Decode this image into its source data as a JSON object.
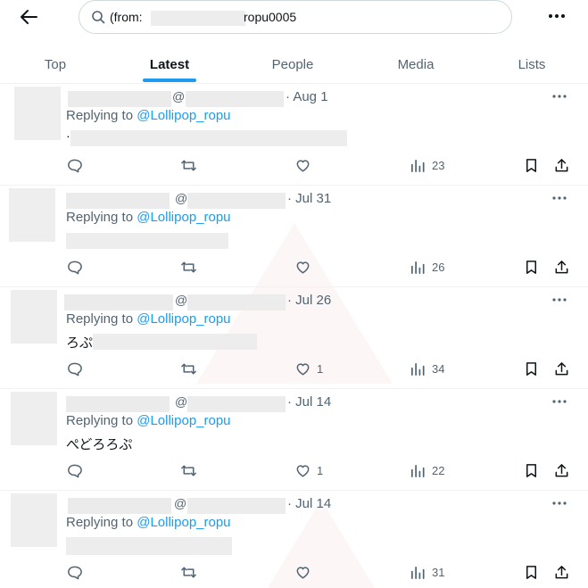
{
  "header": {
    "search_prefix": "(from:",
    "search_suffix": "ropu0005"
  },
  "tabs": [
    {
      "label": "Top"
    },
    {
      "label": "Latest"
    },
    {
      "label": "People"
    },
    {
      "label": "Media"
    },
    {
      "label": "Lists"
    }
  ],
  "active_tab": "Latest",
  "accent_color": "#1d9bf0",
  "tweets": [
    {
      "at": "@",
      "date": "· Aug 1",
      "replying_prefix": "Replying to ",
      "replying_handle": "@Lollipop_ropu",
      "body_text": "·",
      "likes": "",
      "views": "23"
    },
    {
      "at": "@",
      "date": "· Jul 31",
      "replying_prefix": "Replying to ",
      "replying_handle": "@Lollipop_ropu",
      "body_text": "",
      "likes": "",
      "views": "26"
    },
    {
      "at": "@",
      "date": "· Jul 26",
      "replying_prefix": "Replying to ",
      "replying_handle": "@Lollipop_ropu",
      "body_text": "ろぷ",
      "likes": "1",
      "views": "34"
    },
    {
      "at": "@",
      "date": "· Jul 14",
      "replying_prefix": "Replying to ",
      "replying_handle": "@Lollipop_ropu",
      "body_text": "ぺどろろぷ",
      "likes": "1",
      "views": "22"
    },
    {
      "at": "@",
      "date": "· Jul 14",
      "replying_prefix": "Replying to ",
      "replying_handle": "@Lollipop_ropu",
      "body_text": "",
      "likes": "",
      "views": "31"
    }
  ]
}
